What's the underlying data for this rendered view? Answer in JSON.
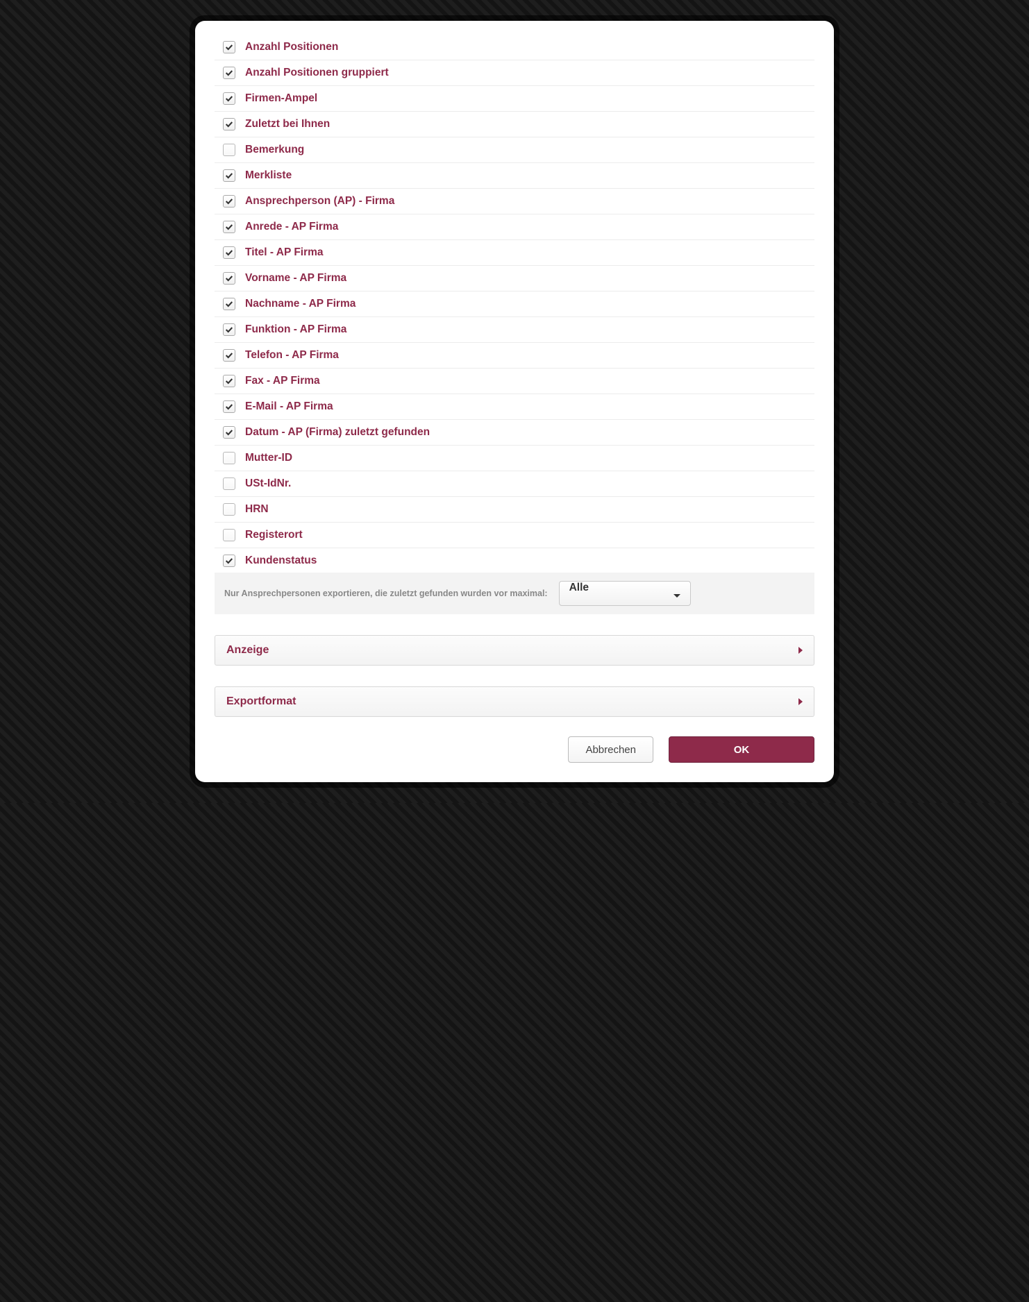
{
  "checklist": [
    {
      "label": "Anzahl Positionen",
      "checked": true
    },
    {
      "label": "Anzahl Positionen gruppiert",
      "checked": true
    },
    {
      "label": "Firmen-Ampel",
      "checked": true
    },
    {
      "label": "Zuletzt bei Ihnen",
      "checked": true
    },
    {
      "label": "Bemerkung",
      "checked": false
    },
    {
      "label": "Merkliste",
      "checked": true
    },
    {
      "label": "Ansprechperson (AP) - Firma",
      "checked": true
    },
    {
      "label": "Anrede - AP Firma",
      "checked": true
    },
    {
      "label": "Titel - AP Firma",
      "checked": true
    },
    {
      "label": "Vorname - AP Firma",
      "checked": true
    },
    {
      "label": "Nachname - AP Firma",
      "checked": true
    },
    {
      "label": "Funktion - AP Firma",
      "checked": true
    },
    {
      "label": "Telefon - AP Firma",
      "checked": true
    },
    {
      "label": "Fax - AP Firma",
      "checked": true
    },
    {
      "label": "E-Mail - AP Firma",
      "checked": true
    },
    {
      "label": "Datum - AP (Firma) zuletzt gefunden",
      "checked": true
    },
    {
      "label": "Mutter-ID",
      "checked": false
    },
    {
      "label": "USt-IdNr.",
      "checked": false
    },
    {
      "label": "HRN",
      "checked": false
    },
    {
      "label": "Registerort",
      "checked": false
    },
    {
      "label": "Kundenstatus",
      "checked": true
    }
  ],
  "filter": {
    "label": "Nur Ansprechpersonen exportieren, die zuletzt gefunden wurden vor maximal:",
    "selected": "Alle"
  },
  "accordions": [
    {
      "title": "Anzeige"
    },
    {
      "title": "Exportformat"
    }
  ],
  "buttons": {
    "cancel": "Abbrechen",
    "ok": "OK"
  }
}
